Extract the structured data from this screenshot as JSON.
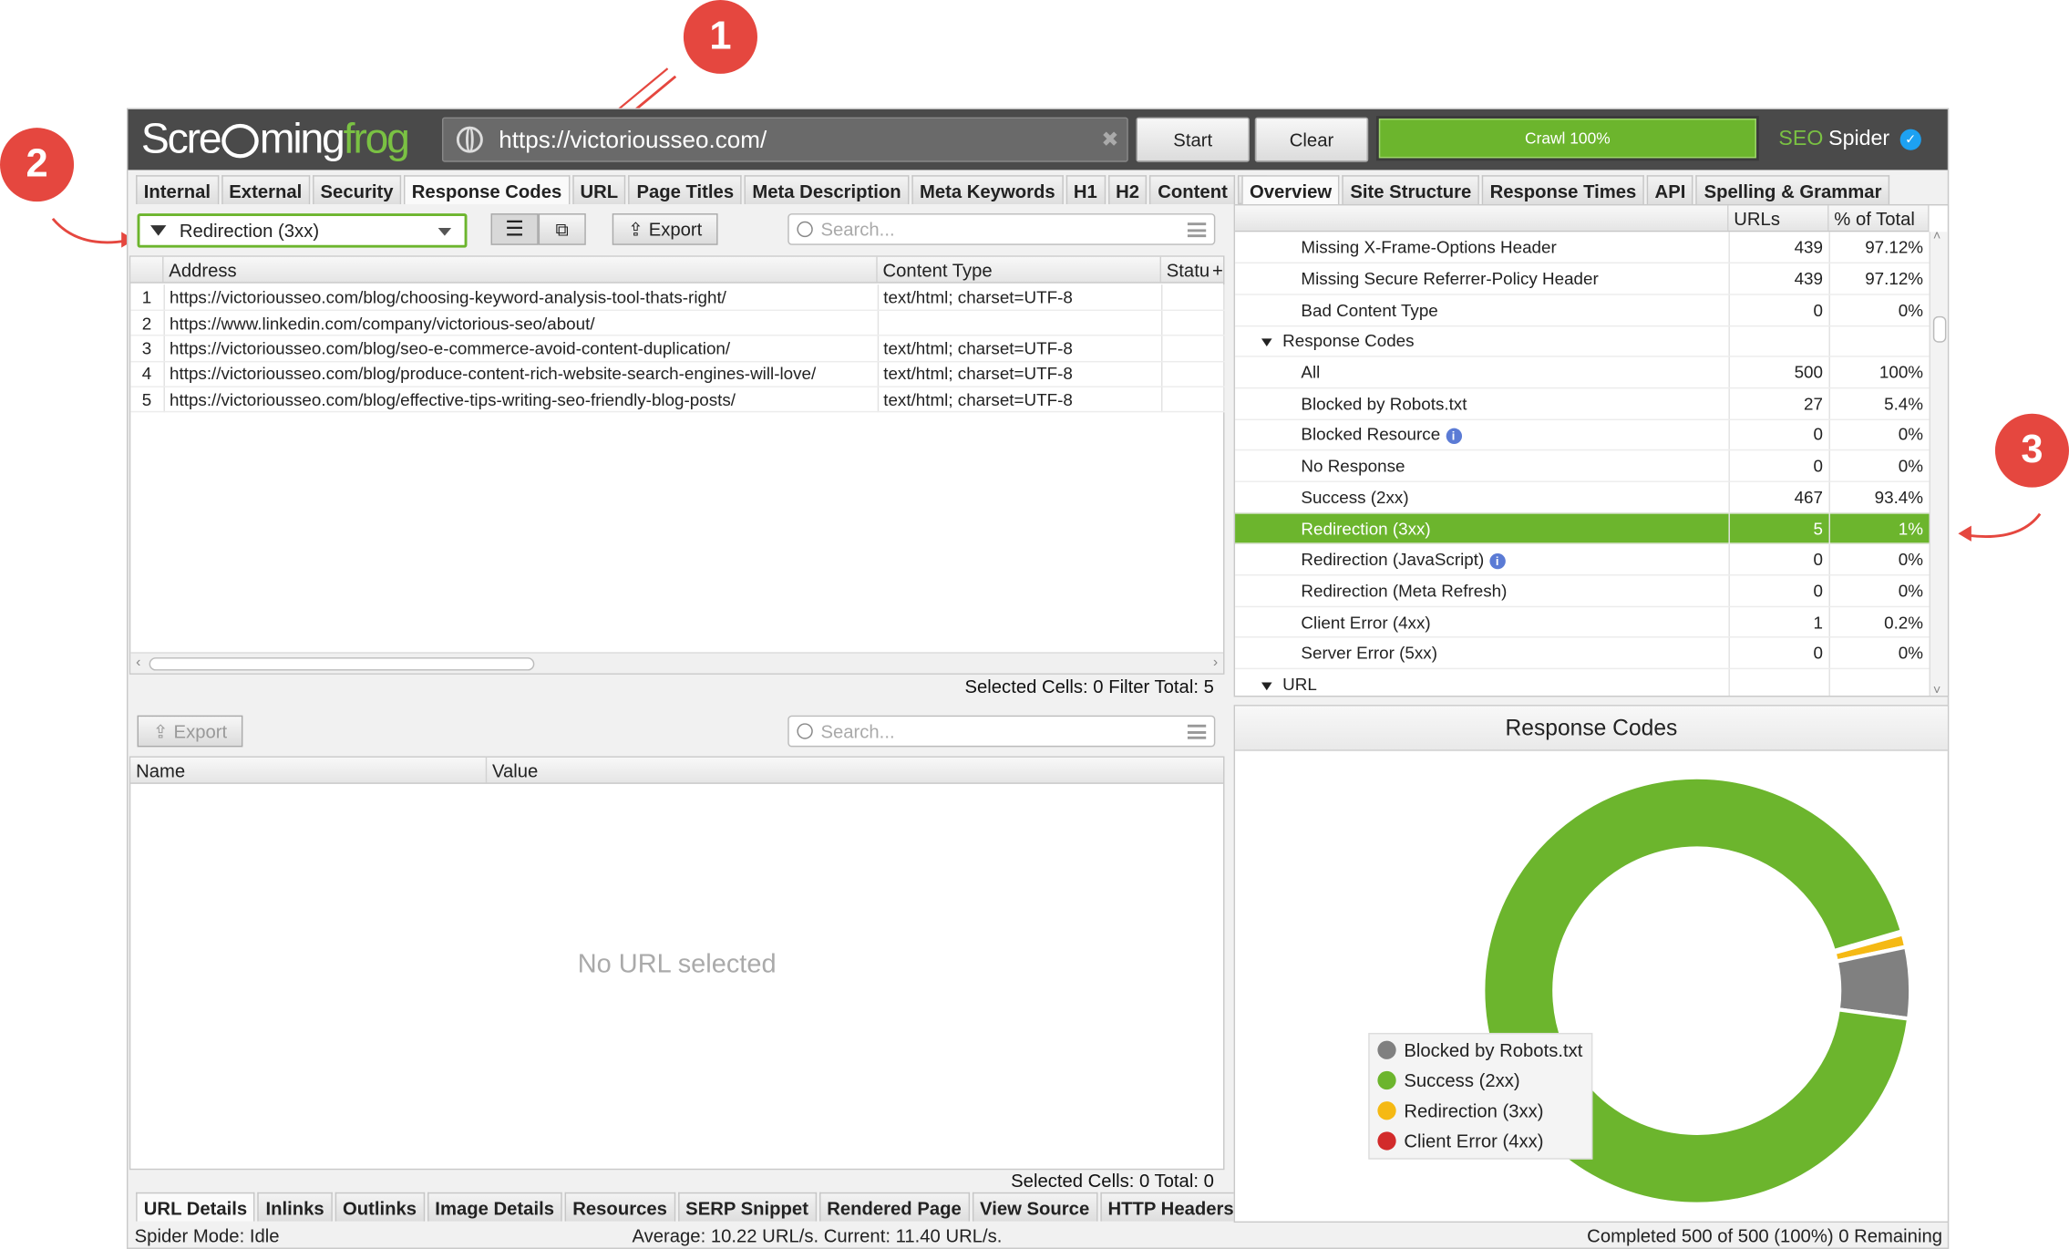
{
  "callouts": [
    "1",
    "2",
    "3"
  ],
  "app": {
    "logo_left": "Scre",
    "logo_mid": "ming",
    "logo_right": "frog",
    "url": "https://victoriousseo.com/",
    "start_label": "Start",
    "clear_label": "Clear",
    "crawl_label": "Crawl 100%",
    "crawl_progress": 1.0,
    "brand_seo": "SEO",
    "brand_spider": "Spider"
  },
  "main_tabs": [
    "Internal",
    "External",
    "Security",
    "Response Codes",
    "URL",
    "Page Titles",
    "Meta Description",
    "Meta Keywords",
    "H1",
    "H2",
    "Content"
  ],
  "main_tabs_active": "Response Codes",
  "filter": {
    "value": "Redirection (3xx)"
  },
  "export_label": "Export",
  "search_placeholder": "Search...",
  "grid": {
    "columns": [
      "Address",
      "Content Type",
      "Statu"
    ],
    "rows": [
      {
        "n": "1",
        "address": "https://victoriousseo.com/blog/choosing-keyword-analysis-tool-thats-right/",
        "type": "text/html; charset=UTF-8"
      },
      {
        "n": "2",
        "address": "https://www.linkedin.com/company/victorious-seo/about/",
        "type": ""
      },
      {
        "n": "3",
        "address": "https://victoriousseo.com/blog/seo-e-commerce-avoid-content-duplication/",
        "type": "text/html; charset=UTF-8"
      },
      {
        "n": "4",
        "address": "https://victoriousseo.com/blog/produce-content-rich-website-search-engines-will-love/",
        "type": "text/html; charset=UTF-8"
      },
      {
        "n": "5",
        "address": "https://victoriousseo.com/blog/effective-tips-writing-seo-friendly-blog-posts/",
        "type": "text/html; charset=UTF-8"
      }
    ],
    "status_text": "Selected Cells:  0  Filter Total:  5"
  },
  "detail": {
    "columns": [
      "Name",
      "Value"
    ],
    "empty_text": "No URL selected",
    "status_text": "Selected Cells:  0  Total:  0"
  },
  "bottom_tabs": [
    "URL Details",
    "Inlinks",
    "Outlinks",
    "Image Details",
    "Resources",
    "SERP Snippet",
    "Rendered Page",
    "View Source",
    "HTTP Headers"
  ],
  "right_tabs": [
    "Overview",
    "Site Structure",
    "Response Times",
    "API",
    "Spelling & Grammar"
  ],
  "overview": {
    "columns": [
      "URLs",
      "% of Total"
    ],
    "rows": [
      {
        "label": "Missing X-Frame-Options Header",
        "urls": "439",
        "pct": "97.12%",
        "kind": "item"
      },
      {
        "label": "Missing Secure Referrer-Policy Header",
        "urls": "439",
        "pct": "97.12%",
        "kind": "item"
      },
      {
        "label": "Bad Content Type",
        "urls": "0",
        "pct": "0%",
        "kind": "item"
      },
      {
        "label": "Response Codes",
        "urls": "",
        "pct": "",
        "kind": "group"
      },
      {
        "label": "All",
        "urls": "500",
        "pct": "100%",
        "kind": "item"
      },
      {
        "label": "Blocked by Robots.txt",
        "urls": "27",
        "pct": "5.4%",
        "kind": "item"
      },
      {
        "label": "Blocked Resource",
        "urls": "0",
        "pct": "0%",
        "kind": "info"
      },
      {
        "label": "No Response",
        "urls": "0",
        "pct": "0%",
        "kind": "item"
      },
      {
        "label": "Success (2xx)",
        "urls": "467",
        "pct": "93.4%",
        "kind": "item"
      },
      {
        "label": "Redirection (3xx)",
        "urls": "5",
        "pct": "1%",
        "kind": "selected"
      },
      {
        "label": "Redirection (JavaScript)",
        "urls": "0",
        "pct": "0%",
        "kind": "info"
      },
      {
        "label": "Redirection (Meta Refresh)",
        "urls": "0",
        "pct": "0%",
        "kind": "item"
      },
      {
        "label": "Client Error (4xx)",
        "urls": "1",
        "pct": "0.2%",
        "kind": "item"
      },
      {
        "label": "Server Error (5xx)",
        "urls": "0",
        "pct": "0%",
        "kind": "item"
      },
      {
        "label": "URL",
        "urls": "",
        "pct": "",
        "kind": "group"
      }
    ]
  },
  "chart_data": {
    "type": "pie",
    "title": "Response Codes",
    "donut": true,
    "categories": [
      "Blocked by Robots.txt",
      "Success (2xx)",
      "Redirection (3xx)",
      "Client Error (4xx)"
    ],
    "values": [
      27,
      467,
      5,
      1
    ],
    "colors": [
      "#808080",
      "#6cb52d",
      "#f5b914",
      "#d22b2b"
    ],
    "legend_position": "left"
  },
  "statusbar": {
    "mode": "Spider Mode: Idle",
    "average": "Average: 10.22 URL/s. Current: 11.40 URL/s.",
    "completed": "Completed 500 of 500 (100%) 0 Remaining"
  },
  "colors": {
    "accent": "#6cb52d",
    "topbar": "#4a4a4a",
    "callout": "#e5473f"
  }
}
